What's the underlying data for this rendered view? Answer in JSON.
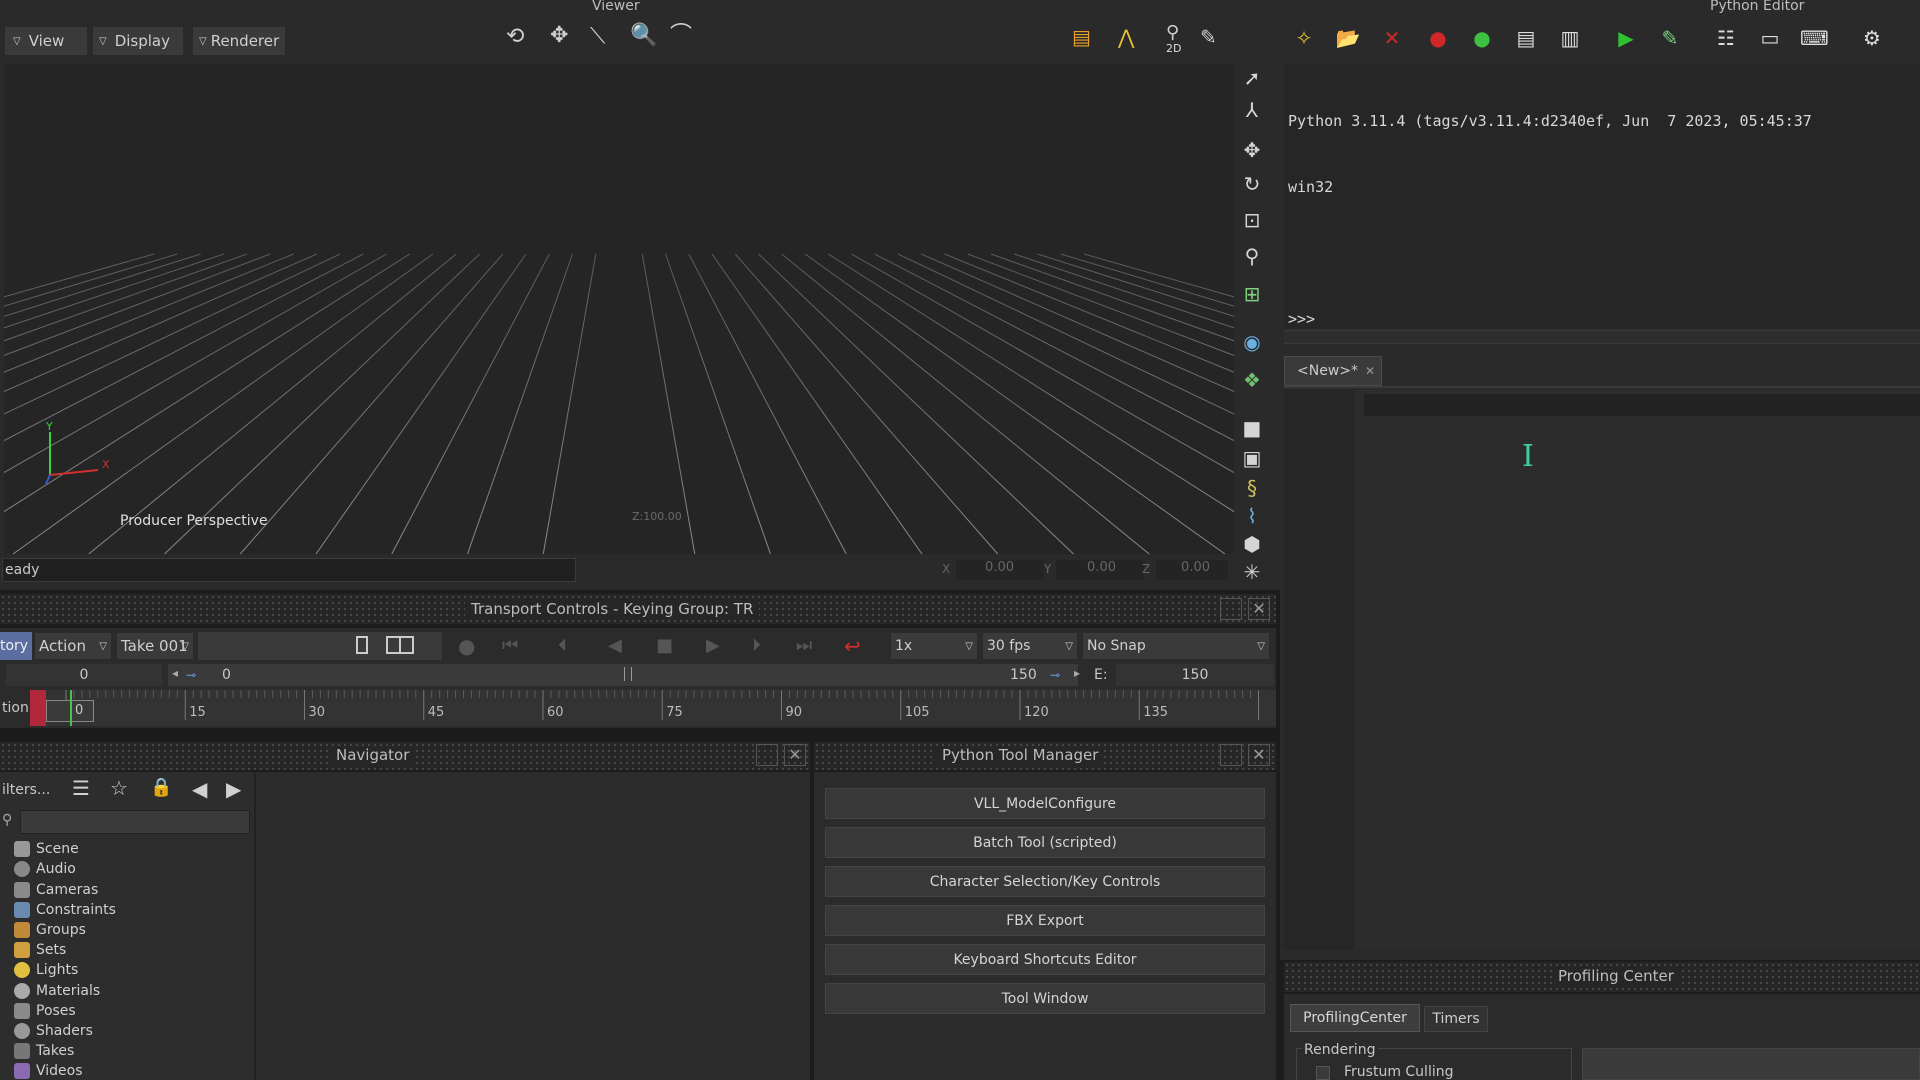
{
  "viewer": {
    "title": "Viewer",
    "menus": [
      "View",
      "Display",
      "Renderer"
    ],
    "camera_label": "Producer Perspective",
    "status": "eady",
    "coords": {
      "x_label": "X",
      "x": "0.00",
      "y_label": "Y",
      "y": "0.00",
      "z_label": "Z",
      "z": "0.00"
    },
    "grid_label": "Z:100.00"
  },
  "transport": {
    "title": "Transport Controls  -  Keying Group: TR",
    "story_tab": "tory",
    "action": "Action",
    "take": "Take 001",
    "speed": "1x",
    "fps": "30 fps",
    "snap": "No Snap",
    "start_value": "0",
    "range_start": "0",
    "range_end": "150",
    "end_label": "E:",
    "end_value": "150",
    "timeline_label": "tion",
    "current_frame": "0",
    "ticks": [
      "15",
      "30",
      "45",
      "60",
      "75",
      "90",
      "105",
      "120",
      "135"
    ]
  },
  "navigator": {
    "title": "Navigator",
    "filters_label": "ilters...",
    "items": [
      "Scene",
      "Audio",
      "Cameras",
      "Constraints",
      "Groups",
      "Sets",
      "Lights",
      "Materials",
      "Poses",
      "Shaders",
      "Takes",
      "Videos"
    ]
  },
  "tool_manager": {
    "title": "Python Tool Manager",
    "tools": [
      "VLL_ModelConfigure",
      "Batch Tool (scripted)",
      "Character Selection/Key Controls",
      "FBX Export",
      "Keyboard Shortcuts Editor",
      "Tool Window"
    ]
  },
  "python_editor": {
    "title": "Python Editor",
    "output_line1": "Python 3.11.4 (tags/v3.11.4:d2340ef, Jun  7 2023, 05:45:37",
    "output_line2": "win32",
    "prompts": [
      ">>>",
      ">>>",
      ">>>"
    ],
    "tab_label": "<New>*"
  },
  "profiling": {
    "title": "Profiling Center",
    "tabs": [
      "ProfilingCenter",
      "Timers"
    ],
    "section": "Rendering",
    "checkbox_label": "Frustum Culling"
  }
}
